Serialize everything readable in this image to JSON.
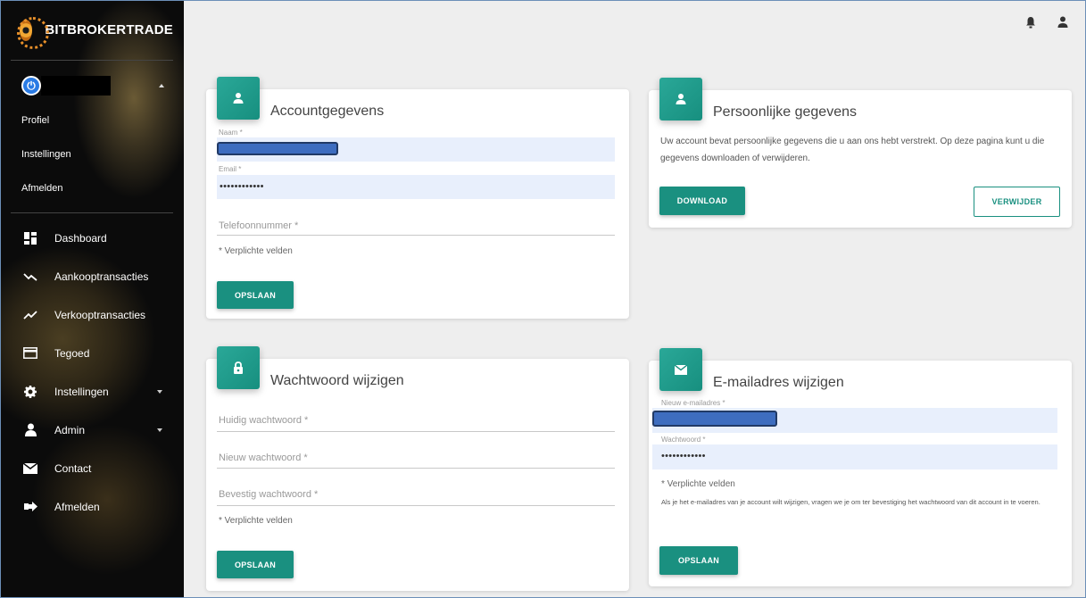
{
  "sidebar": {
    "brand": "BITBROKERTRADE",
    "user_menu": [
      "Profiel",
      "Instellingen",
      "Afmelden"
    ],
    "nav": [
      {
        "label": "Dashboard",
        "icon": "dashboard-icon"
      },
      {
        "label": "Aankooptransacties",
        "icon": "trending-down-icon"
      },
      {
        "label": "Verkooptransacties",
        "icon": "trending-up-icon"
      },
      {
        "label": "Tegoed",
        "icon": "credit-card-icon"
      },
      {
        "label": "Instellingen",
        "icon": "gear-icon",
        "has_caret": true
      },
      {
        "label": "Admin",
        "icon": "person-icon",
        "has_caret": true
      },
      {
        "label": "Contact",
        "icon": "mail-icon"
      },
      {
        "label": "Afmelden",
        "icon": "logout-icon"
      }
    ]
  },
  "topbar": {
    "icons": [
      "bell-icon",
      "person-icon"
    ]
  },
  "account": {
    "title": "Accountgegevens",
    "name_label": "Naam *",
    "email_label": "Email *",
    "email_value": "••••••••••••",
    "phone_placeholder": "Telefoonnummer *",
    "required_note": "* Verplichte velden",
    "save": "OPSLAAN"
  },
  "personal": {
    "title": "Persoonlijke gegevens",
    "text": "Uw account bevat persoonlijke gegevens die u aan ons hebt verstrekt. Op deze pagina kunt u die gegevens downloaden of verwijderen.",
    "download": "DOWNLOAD",
    "delete": "VERWIJDER"
  },
  "password": {
    "title": "Wachtwoord wijzigen",
    "current": "Huidig wachtwoord *",
    "new": "Nieuw wachtwoord *",
    "confirm": "Bevestig wachtwoord *",
    "required_note": "* Verplichte velden",
    "save": "OPSLAAN"
  },
  "email_change": {
    "title": "E-mailadres wijzigen",
    "new_email_label": "Nieuw e-mailadres *",
    "password_label": "Wachtwoord *",
    "password_value": "••••••••••••",
    "required_note": "* Verplichte velden",
    "info": "Als je het e-mailadres van je account wilt wijzigen, vragen we je om ter bevestiging het wachtwoord van dit account in te voeren.",
    "save": "OPSLAAN"
  },
  "colors": {
    "accent": "#1a9080",
    "sidebar_bg": "#0b0b0b",
    "field_bg": "#e8effc"
  }
}
